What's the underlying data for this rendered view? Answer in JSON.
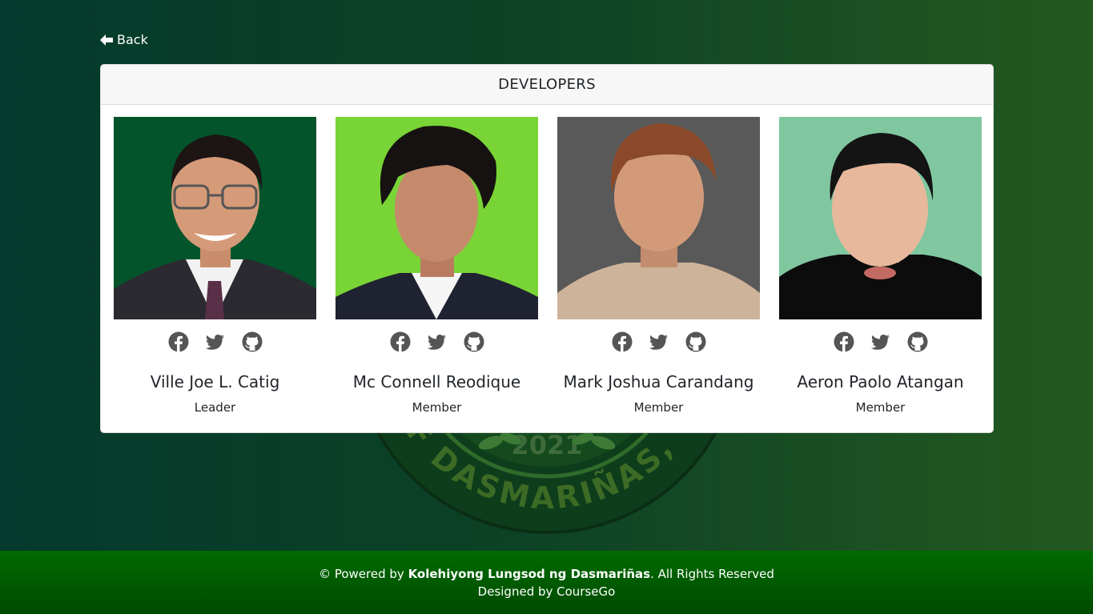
{
  "nav": {
    "back_label": "Back",
    "back_icon": "arrow-left-icon"
  },
  "card": {
    "title": "DEVELOPERS"
  },
  "seal": {
    "year": "2021",
    "ring_text": "CITY OF DASMARIÑAS, CAVITE"
  },
  "developers": [
    {
      "name": "Ville Joe L. Catig",
      "role": "Leader",
      "photo_bg": "#03542a",
      "icons": [
        "facebook-icon",
        "twitter-icon",
        "github-icon"
      ]
    },
    {
      "name": "Mc Connell Reodique",
      "role": "Member",
      "photo_bg": "#79d435",
      "icons": [
        "facebook-icon",
        "twitter-icon",
        "github-icon"
      ]
    },
    {
      "name": "Mark Joshua Carandang",
      "role": "Member",
      "photo_bg": "#595959",
      "icons": [
        "facebook-icon",
        "twitter-icon",
        "github-icon"
      ]
    },
    {
      "name": "Aeron Paolo Atangan",
      "role": "Member",
      "photo_bg": "#80c7a0",
      "icons": [
        "facebook-icon",
        "twitter-icon",
        "github-icon"
      ]
    }
  ],
  "footer": {
    "powered_prefix": "© Powered by ",
    "powered_org": "Kolehiyong Lungsod ng Dasmariñas",
    "powered_suffix": ". All Rights Reserved",
    "designed": "Designed by CourseGo"
  },
  "colors": {
    "footer_green": "#006b00",
    "icon_gray": "#555555",
    "bg_dark": "#043a2d",
    "bg_light": "#23591f"
  }
}
